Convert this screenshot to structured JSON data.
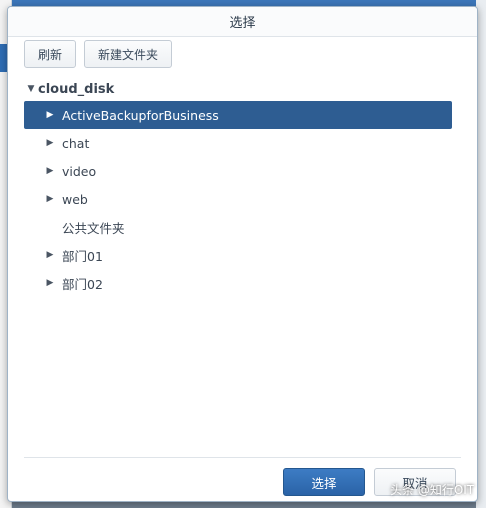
{
  "dialog": {
    "title": "选择"
  },
  "toolbar": {
    "refresh_label": "刷新",
    "new_folder_label": "新建文件夹"
  },
  "tree": {
    "root_label": "cloud_disk",
    "items": [
      {
        "label": "ActiveBackupforBusiness",
        "has_children": true,
        "selected": true
      },
      {
        "label": "chat",
        "has_children": true,
        "selected": false
      },
      {
        "label": "video",
        "has_children": true,
        "selected": false
      },
      {
        "label": "web",
        "has_children": true,
        "selected": false
      },
      {
        "label": "公共文件夹",
        "has_children": false,
        "selected": false
      },
      {
        "label": "部门01",
        "has_children": true,
        "selected": false
      },
      {
        "label": "部门02",
        "has_children": true,
        "selected": false
      }
    ]
  },
  "footer": {
    "select_label": "选择",
    "cancel_label": "取消"
  },
  "watermark": {
    "text": "头条 @知行OIT"
  },
  "icons": {
    "expanded": "caret-down-icon",
    "collapsed": "caret-right-icon"
  },
  "colors": {
    "selected_row": "#2e5d92",
    "primary_button": "#2a63a7"
  }
}
